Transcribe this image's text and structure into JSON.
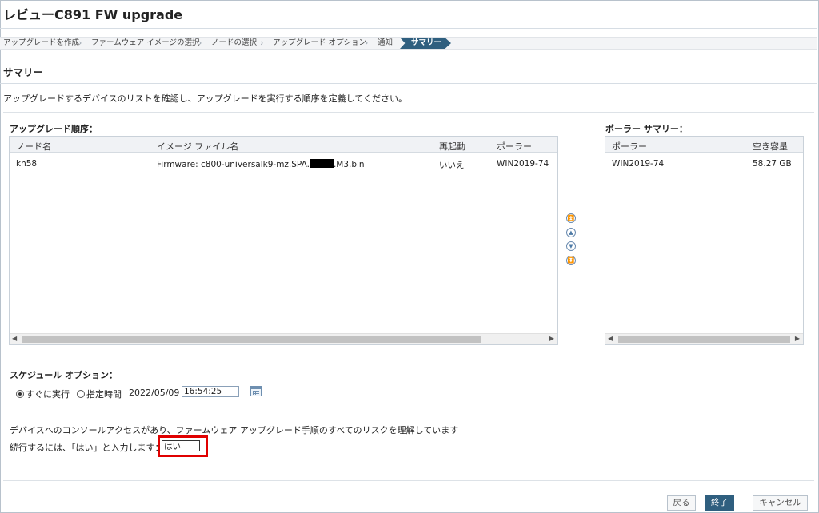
{
  "window": {
    "title": "レビューC891 FW upgrade"
  },
  "breadcrumb": {
    "steps": [
      "アップグレードを作成",
      "ファームウェア イメージの選択",
      "ノードの選択",
      "アップグレード オプション",
      "通知",
      "サマリー"
    ],
    "active": "サマリー"
  },
  "page": {
    "section_title": "サマリー",
    "description": "アップグレードするデバイスのリストを確認し、アップグレードを実行する順序を定義してください。"
  },
  "upgrade_order": {
    "label": "アップグレード順序：",
    "columns": [
      "ノード名",
      "イメージ ファイル名",
      "再起動",
      "ポーラー"
    ],
    "rows": [
      {
        "node": "kn58",
        "image_prefix": "Firmware: c800-universalk9-mz.SPA.",
        "image_suffix": ".M3.bin",
        "reboot": "いいえ",
        "poller": "WIN2019-74"
      }
    ]
  },
  "reorder_buttons": [
    "move-top-icon",
    "move-up-icon",
    "move-down-icon",
    "move-bottom-icon"
  ],
  "poller_summary": {
    "label": "ポーラー サマリー：",
    "columns": [
      "ポーラー",
      "空き容量"
    ],
    "rows": [
      {
        "poller": "WIN2019-74",
        "free_space": "58.27 GB"
      }
    ]
  },
  "schedule": {
    "label": "スケジュール オプション：",
    "option_now": "すぐに実行",
    "option_specified": "指定時間",
    "selected": "すぐに実行",
    "date": "2022/05/09",
    "time": "16:54:25"
  },
  "confirm": {
    "statement": "デバイスへのコンソールアクセスがあり、ファームウェア アップグレード手順のすべてのリスクを理解しています",
    "prompt": "続行するには、「はい」と入力します：",
    "value": "はい",
    "highlight_color": "#e00000"
  },
  "footer": {
    "back": "戻る",
    "finish": "終了",
    "cancel": "キャンセル"
  },
  "colors": {
    "accent": "#2f5f7f"
  }
}
